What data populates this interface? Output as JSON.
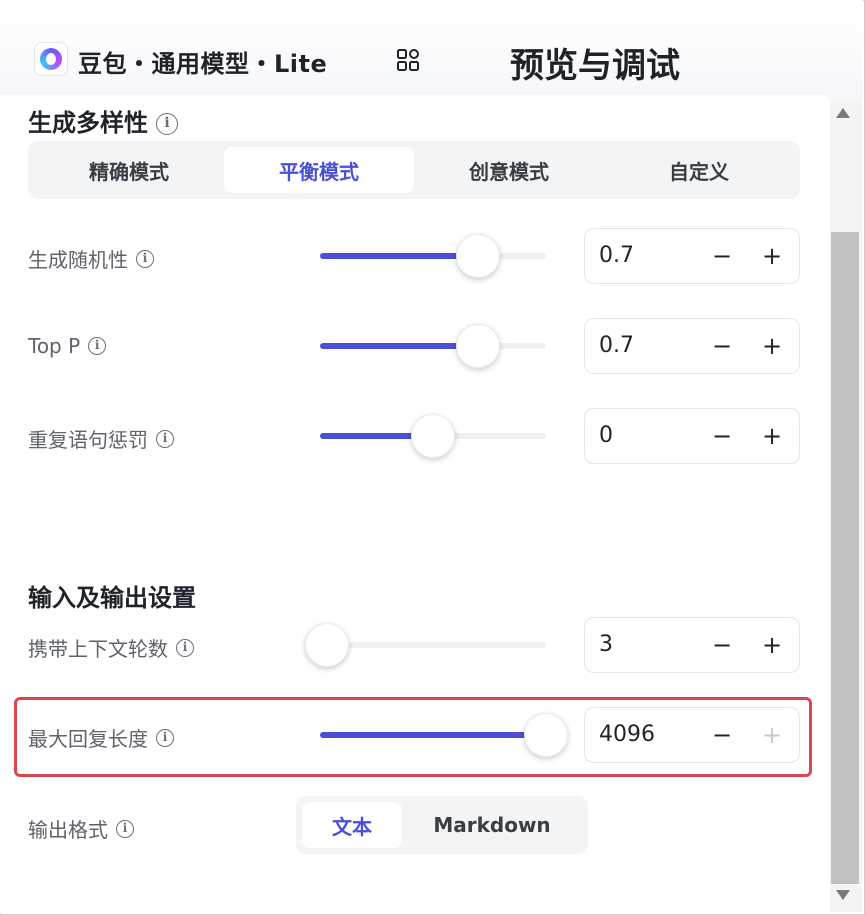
{
  "header": {
    "model_name": "豆包・通用模型・Lite",
    "page_title": "预览与调试"
  },
  "diversity": {
    "title": "生成多样性",
    "modes": [
      {
        "label": "精确模式",
        "active": false
      },
      {
        "label": "平衡模式",
        "active": true
      },
      {
        "label": "创意模式",
        "active": false
      },
      {
        "label": "自定义",
        "active": false
      }
    ]
  },
  "params": {
    "temperature": {
      "label": "生成随机性",
      "value": "0.7",
      "level": 0.7
    },
    "top_p": {
      "label": "Top P",
      "value": "0.7",
      "level": 0.7
    },
    "repetition": {
      "label": "重复语句惩罚",
      "value": "0",
      "level": 0.5
    }
  },
  "io": {
    "title": "输入及输出设置",
    "context_rounds": {
      "label": "携带上下文轮数",
      "value": "3",
      "level": 0.0
    },
    "max_length": {
      "label": "最大回复长度",
      "value": "4096",
      "level": 1.0
    },
    "output_format": {
      "label": "输出格式",
      "options": [
        {
          "label": "文本",
          "active": true
        },
        {
          "label": "Markdown",
          "active": false
        }
      ]
    }
  },
  "stepper": {
    "minus": "−",
    "plus": "+"
  },
  "info_glyph": "i",
  "colors": {
    "accent": "#4b4fd6",
    "highlight": "#d9474f"
  }
}
